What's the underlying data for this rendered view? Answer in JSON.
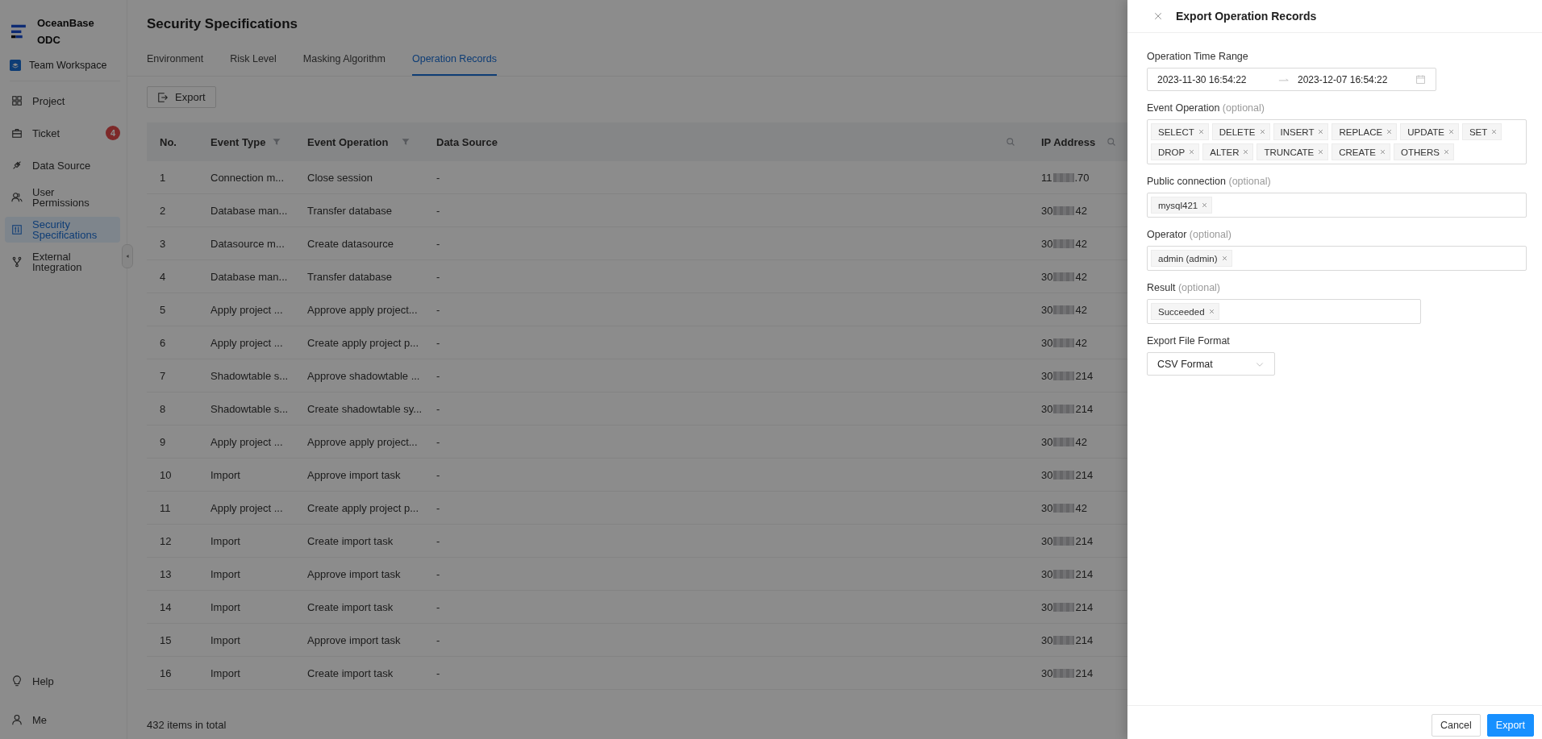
{
  "sidebar": {
    "logo_lines": [
      "OceanBase",
      "ODC"
    ],
    "workspace": "Team Workspace",
    "items": [
      {
        "label": "Project",
        "selected": false
      },
      {
        "label": "Ticket",
        "selected": false,
        "badge": "4"
      },
      {
        "label": "Data Source",
        "selected": false
      },
      {
        "label": "User Permissions",
        "selected": false
      },
      {
        "label": "Security Specifications",
        "selected": true
      },
      {
        "label": "External Integration",
        "selected": false
      }
    ],
    "bottom_items": [
      {
        "label": "Help"
      },
      {
        "label": "Me"
      }
    ]
  },
  "page": {
    "title": "Security Specifications",
    "tabs": [
      {
        "label": "Environment",
        "selected": false
      },
      {
        "label": "Risk Level",
        "selected": false
      },
      {
        "label": "Masking Algorithm",
        "selected": false
      },
      {
        "label": "Operation Records",
        "selected": true
      }
    ],
    "export_button": "Export",
    "table": {
      "columns": [
        {
          "label": "No.",
          "filter": false,
          "search": false
        },
        {
          "label": "Event Type",
          "filter": true,
          "search": false
        },
        {
          "label": "Event Operation",
          "filter": true,
          "search": false
        },
        {
          "label": "Data Source",
          "filter": false,
          "search": true
        },
        {
          "label": "IP Address",
          "filter": false,
          "search": true
        }
      ],
      "rows": [
        {
          "no": "1",
          "event_type": "Connection m...",
          "event_operation": "Close session",
          "data_source": "-",
          "ip_start": "11",
          "ip_end": ".70"
        },
        {
          "no": "2",
          "event_type": "Database man...",
          "event_operation": "Transfer database",
          "data_source": "-",
          "ip_start": "30",
          "ip_end": "42"
        },
        {
          "no": "3",
          "event_type": "Datasource m...",
          "event_operation": "Create datasource",
          "data_source": "-",
          "ip_start": "30",
          "ip_end": "42"
        },
        {
          "no": "4",
          "event_type": "Database man...",
          "event_operation": "Transfer database",
          "data_source": "-",
          "ip_start": "30",
          "ip_end": "42"
        },
        {
          "no": "5",
          "event_type": "Apply project ...",
          "event_operation": "Approve apply project...",
          "data_source": "-",
          "ip_start": "30",
          "ip_end": "42"
        },
        {
          "no": "6",
          "event_type": "Apply project ...",
          "event_operation": "Create apply project p...",
          "data_source": "-",
          "ip_start": "30",
          "ip_end": "42"
        },
        {
          "no": "7",
          "event_type": "Shadowtable s...",
          "event_operation": "Approve shadowtable ...",
          "data_source": "-",
          "ip_start": "30",
          "ip_end": "214"
        },
        {
          "no": "8",
          "event_type": "Shadowtable s...",
          "event_operation": "Create shadowtable sy...",
          "data_source": "-",
          "ip_start": "30",
          "ip_end": "214"
        },
        {
          "no": "9",
          "event_type": "Apply project ...",
          "event_operation": "Approve apply project...",
          "data_source": "-",
          "ip_start": "30",
          "ip_end": "42"
        },
        {
          "no": "10",
          "event_type": "Import",
          "event_operation": "Approve import task",
          "data_source": "-",
          "ip_start": "30",
          "ip_end": "214"
        },
        {
          "no": "11",
          "event_type": "Apply project ...",
          "event_operation": "Create apply project p...",
          "data_source": "-",
          "ip_start": "30",
          "ip_end": "42"
        },
        {
          "no": "12",
          "event_type": "Import",
          "event_operation": "Create import task",
          "data_source": "-",
          "ip_start": "30",
          "ip_end": "214"
        },
        {
          "no": "13",
          "event_type": "Import",
          "event_operation": "Approve import task",
          "data_source": "-",
          "ip_start": "30",
          "ip_end": "214"
        },
        {
          "no": "14",
          "event_type": "Import",
          "event_operation": "Create import task",
          "data_source": "-",
          "ip_start": "30",
          "ip_end": "214"
        },
        {
          "no": "15",
          "event_type": "Import",
          "event_operation": "Approve import task",
          "data_source": "-",
          "ip_start": "30",
          "ip_end": "214"
        },
        {
          "no": "16",
          "event_type": "Import",
          "event_operation": "Create import task",
          "data_source": "-",
          "ip_start": "30",
          "ip_end": "214"
        }
      ]
    },
    "total": "432 items in total"
  },
  "drawer": {
    "title": "Export Operation Records",
    "fields": [
      {
        "kind": "range",
        "label": "Operation Time Range",
        "start": "2023-11-30 16:54:22",
        "end": "2023-12-07 16:54:22"
      },
      {
        "kind": "tags",
        "label": "Event Operation",
        "optional": "(optional)",
        "tags": [
          "SELECT",
          "DELETE",
          "INSERT",
          "REPLACE",
          "UPDATE",
          "SET",
          "DROP",
          "ALTER",
          "TRUNCATE",
          "CREATE",
          "OTHERS"
        ]
      },
      {
        "kind": "tags",
        "label": "Public connection",
        "optional": "(optional)",
        "tags": [
          "mysql421"
        ]
      },
      {
        "kind": "tags",
        "label": "Operator",
        "optional": "(optional)",
        "tags": [
          "admin (admin)"
        ]
      },
      {
        "kind": "tags-short",
        "label": "Result",
        "optional": "(optional)",
        "tags": [
          "Succeeded"
        ]
      },
      {
        "kind": "select",
        "label": "Export File Format",
        "value": "CSV Format"
      }
    ],
    "buttons": [
      {
        "label": "Cancel",
        "primary": false
      },
      {
        "label": "Export",
        "primary": true
      }
    ]
  }
}
